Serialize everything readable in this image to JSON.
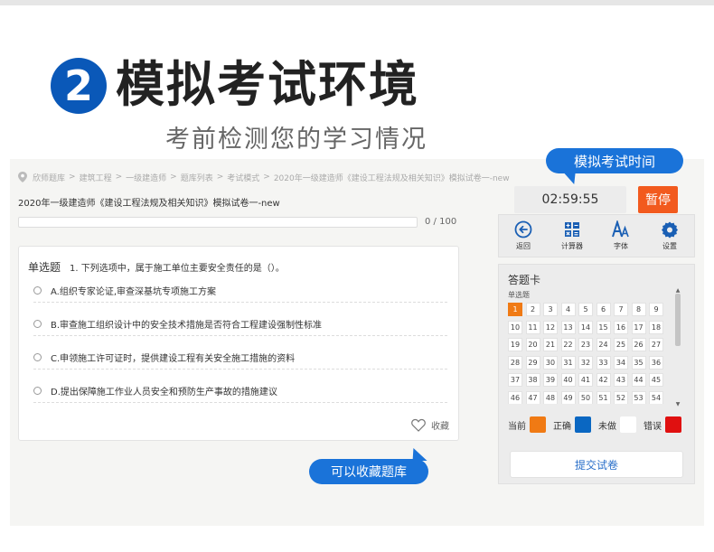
{
  "hero": {
    "badge": "2",
    "title": "模拟考试环境",
    "subtitle": "考前检测您的学习情况"
  },
  "breadcrumb": [
    "欣师题库",
    "建筑工程",
    "一级建造师",
    "题库列表",
    "考试模式",
    "2020年一级建造师《建设工程法规及相关知识》模拟试卷一-new"
  ],
  "breadcrumb_separator": ">",
  "paper": {
    "title": "2020年一级建造师《建设工程法规及相关知识》模拟试卷一-new",
    "progress_fraction": 0,
    "progress_text": "0 / 100"
  },
  "question": {
    "type": "单选题",
    "stem": "1. 下列选项中，属于施工单位主要安全责任的是（）。",
    "options": [
      "A.组织专家论证,审查深基坑专项施工方案",
      "B.审查施工组织设计中的安全技术措施是否符合工程建设强制性标准",
      "C.申领施工许可证时，提供建设工程有关安全施工措施的资料",
      "D.提出保障施工作业人员安全和预防生产事故的措施建议"
    ],
    "favorite_label": "收藏",
    "favorite_icon": "heart-icon"
  },
  "callouts": {
    "favorite": "可以收藏题库",
    "timer": "模拟考试时间"
  },
  "timer": {
    "value": "02:59:55",
    "pause_label": "暂停"
  },
  "toolbar": [
    {
      "label": "返回",
      "icon": "back-arrow-icon"
    },
    {
      "label": "计算器",
      "icon": "calculator-icon"
    },
    {
      "label": "字体",
      "icon": "font-icon"
    },
    {
      "label": "设置",
      "icon": "gear-icon"
    }
  ],
  "answer_card": {
    "title": "答题卡",
    "section": "单选题",
    "numbers": [
      "1",
      "2",
      "3",
      "4",
      "5",
      "6",
      "7",
      "8",
      "9",
      "10",
      "11",
      "12",
      "13",
      "14",
      "15",
      "16",
      "17",
      "18",
      "19",
      "20",
      "21",
      "22",
      "23",
      "24",
      "25",
      "26",
      "27",
      "28",
      "29",
      "30",
      "31",
      "32",
      "33",
      "34",
      "35",
      "36",
      "37",
      "38",
      "39",
      "40",
      "41",
      "42",
      "43",
      "44",
      "45",
      "46",
      "47",
      "48",
      "49",
      "50",
      "51",
      "52",
      "53",
      "54"
    ],
    "current": "1",
    "legend": [
      {
        "label": "当前",
        "color": "#f07a14"
      },
      {
        "label": "正确",
        "color": "#0a67c2"
      },
      {
        "label": "未做",
        "color": "#ffffff"
      },
      {
        "label": "错误",
        "color": "#e01010"
      }
    ],
    "submit_label": "提交试卷"
  },
  "colors": {
    "accent_blue": "#1a73d9",
    "pause_orange": "#f25a1e",
    "icon_blue": "#1a5fb4"
  }
}
